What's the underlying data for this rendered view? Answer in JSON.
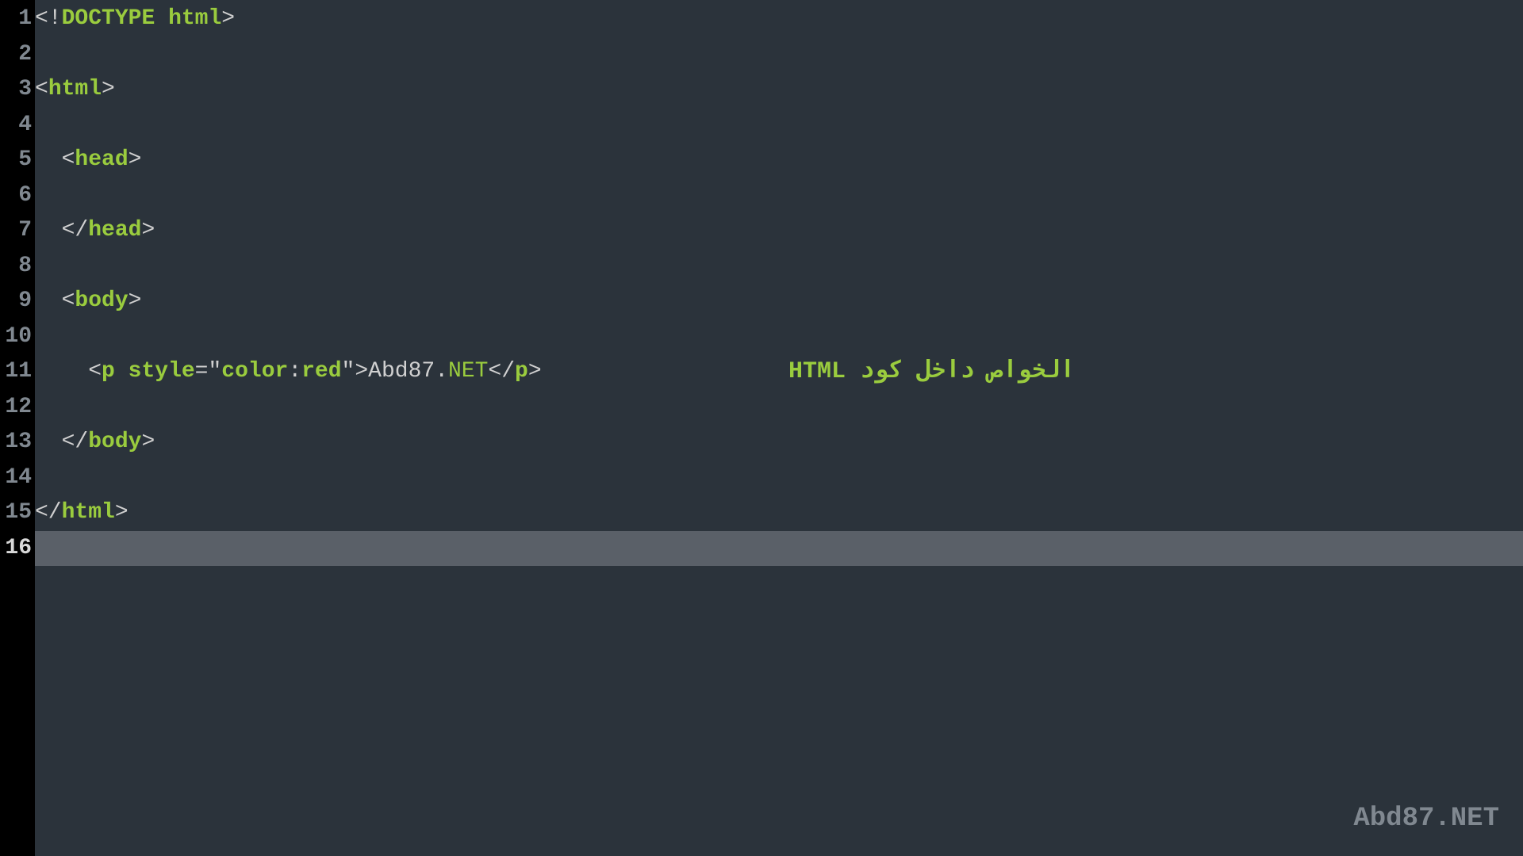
{
  "gutter": {
    "numbers": [
      "1",
      "2",
      "3",
      "4",
      "5",
      "6",
      "7",
      "8",
      "9",
      "10",
      "11",
      "12",
      "13",
      "14",
      "15",
      "16"
    ],
    "active_index": 15
  },
  "code": {
    "line1": {
      "lt": "<",
      "excl": "!",
      "doctype": "DOCTYPE",
      "sp": " ",
      "html": "html",
      "gt": ">"
    },
    "line3": {
      "lt": "<",
      "tag": "html",
      "gt": ">"
    },
    "line5": {
      "indent": "  ",
      "lt": "<",
      "tag": "head",
      "gt": ">"
    },
    "line7": {
      "indent": "  ",
      "lts": "</",
      "tag": "head",
      "gt": ">"
    },
    "line9": {
      "indent": "  ",
      "lt": "<",
      "tag": "body",
      "gt": ">"
    },
    "line11": {
      "indent": "    ",
      "lt": "<",
      "tag": "p",
      "sp": " ",
      "attr": "style",
      "eq": "=",
      "q1": "\"",
      "color": "color",
      "colon": ":",
      "red": "red",
      "q2": "\"",
      "gt": ">",
      "txt1": "Abd87",
      "dot": ".",
      "txt2": "NET",
      "lts": "</",
      "tagc": "p",
      "gt2": ">"
    },
    "line13": {
      "indent": "  ",
      "lts": "</",
      "tag": "body",
      "gt": ">"
    },
    "line15": {
      "lts": "</",
      "tag": "html",
      "gt": ">"
    }
  },
  "annotation": "الخواص داخل كود HTML",
  "watermark": "Abd87.NET"
}
